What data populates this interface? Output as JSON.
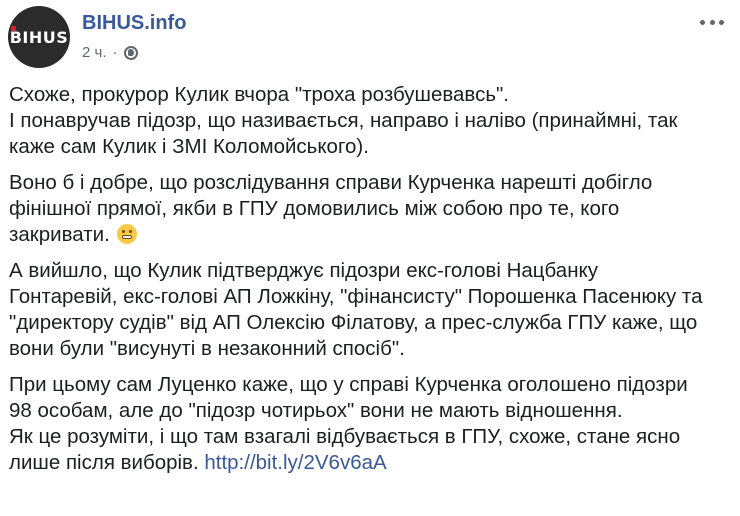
{
  "page": {
    "name": "BIHUS.info",
    "avatar_text": "BIHUS",
    "time": "2 ч.",
    "separator": "·",
    "privacy_icon": "globe-icon",
    "menu_icon": "more-options-icon"
  },
  "colors": {
    "link": "#385898",
    "text": "#1c1e21",
    "meta": "#606770"
  },
  "post": {
    "p1": [
      "Схоже, прокурор Кулик вчора \"троха розбушевавсь\".",
      "І понавручав підозр, що називається, направо і наліво (принаймні, так",
      "каже сам Кулик і ЗМІ Коломойського)."
    ],
    "p2": [
      "Воно б і добре, що розслідування справи Курченка нарешті добігло",
      "фінішної прямої, якби в ГПУ домовились між собою про те, кого",
      "закривати."
    ],
    "p2_emoji": "grimacing-face-emoji",
    "p3": [
      "А вийшло, що Кулик підтверджує підозри екс-голові Нацбанку",
      "Гонтаревій, екс-голові АП Ложкіну, \"фінансисту\" Порошенка Пасенюку та",
      "\"директору судів\" від АП Олексію Філатову, а прес-служба ГПУ каже, що",
      "вони були \"висунуті в незаконний спосіб\"."
    ],
    "p4": [
      "При цьому сам Луценко каже, що у справі Курченка оголошено підозри",
      "98 особам, але до \"підозр чотирьох\" вони не мають відношення.",
      "Як це розуміти, і що там взагалі відбувається в ГПУ, схоже, стане ясно"
    ],
    "p4_last_prefix": "лише після виборів.",
    "link": "http://bit.ly/2V6v6aA"
  }
}
